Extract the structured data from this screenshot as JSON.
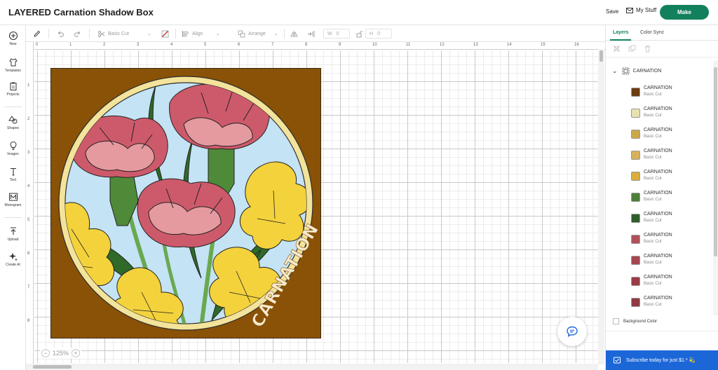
{
  "header": {
    "title": "LAYERED Carnation Shadow Box",
    "save_label": "Save",
    "mystuff_label": "My Stuff",
    "make_label": "Make"
  },
  "leftnav": {
    "items": [
      {
        "label": "New",
        "icon": "plus-circle-icon"
      },
      {
        "label": "Templates",
        "icon": "shirt-icon"
      },
      {
        "label": "Projects",
        "icon": "clipboard-icon"
      },
      {
        "label": "Shapes",
        "icon": "shapes-icon"
      },
      {
        "label": "Images",
        "icon": "lightbulb-icon"
      },
      {
        "label": "Text",
        "icon": "text-icon"
      },
      {
        "label": "Monogram",
        "icon": "monogram-icon"
      },
      {
        "label": "Upload",
        "icon": "upload-icon"
      },
      {
        "label": "Create AI",
        "icon": "sparkle-icon"
      }
    ]
  },
  "toolbar": {
    "operation": "Basic Cut",
    "align": "Align",
    "arrange": "Arrange",
    "w_label": "W",
    "w_value": "0",
    "h_label": "H",
    "h_value": "0"
  },
  "canvas": {
    "ruler_h": [
      "0",
      "1",
      "2",
      "3",
      "4",
      "5",
      "6",
      "7",
      "8",
      "9",
      "10",
      "11",
      "12",
      "13",
      "14",
      "15",
      "16"
    ],
    "ruler_v": [
      "1",
      "2",
      "3",
      "4",
      "5",
      "6",
      "7",
      "8"
    ],
    "zoom_value": "125%",
    "design_text": "CARNATION"
  },
  "colors": {
    "frame_brown": "#8a5206",
    "sky_blue": "#c4e3f4",
    "gold_ring": "#f3e39b",
    "pink_petal": "#cd5a6b",
    "light_pink": "#e59aa0",
    "leaf_green": "#2f6a28",
    "stem_green": "#6aa84f",
    "yellow_petal": "#f4d23c",
    "accent_green": "#13805d",
    "banner_blue": "#1c67d8"
  },
  "rightpanel": {
    "tabs": [
      "Layers",
      "Color Sync"
    ],
    "group_name": "CARNATION",
    "layers": [
      {
        "name": "CARNATION",
        "type": "Basic Cut",
        "color": "#6b3d10"
      },
      {
        "name": "CARNATION",
        "type": "Basic Cut",
        "color": "#e8e2b0"
      },
      {
        "name": "CARNATION",
        "type": "Basic Cut",
        "color": "#caa84a"
      },
      {
        "name": "CARNATION",
        "type": "Basic Cut",
        "color": "#d8b25a"
      },
      {
        "name": "CARNATION",
        "type": "Basic Cut",
        "color": "#d9ad3e"
      },
      {
        "name": "CARNATION",
        "type": "Basic Cut",
        "color": "#4d7f3a"
      },
      {
        "name": "CARNATION",
        "type": "Basic Cut",
        "color": "#2f5e2a"
      },
      {
        "name": "CARNATION",
        "type": "Basic Cut",
        "color": "#b0505a"
      },
      {
        "name": "CARNATION",
        "type": "Basic Cut",
        "color": "#a64650"
      },
      {
        "name": "CARNATION",
        "type": "Basic Cut",
        "color": "#9a3c46"
      },
      {
        "name": "CARNATION",
        "type": "Basic Cut",
        "color": "#8f3a44"
      }
    ],
    "background_color_label": "Background Color",
    "subscribe_text": "Subscribe today for just $1.* 💫"
  }
}
